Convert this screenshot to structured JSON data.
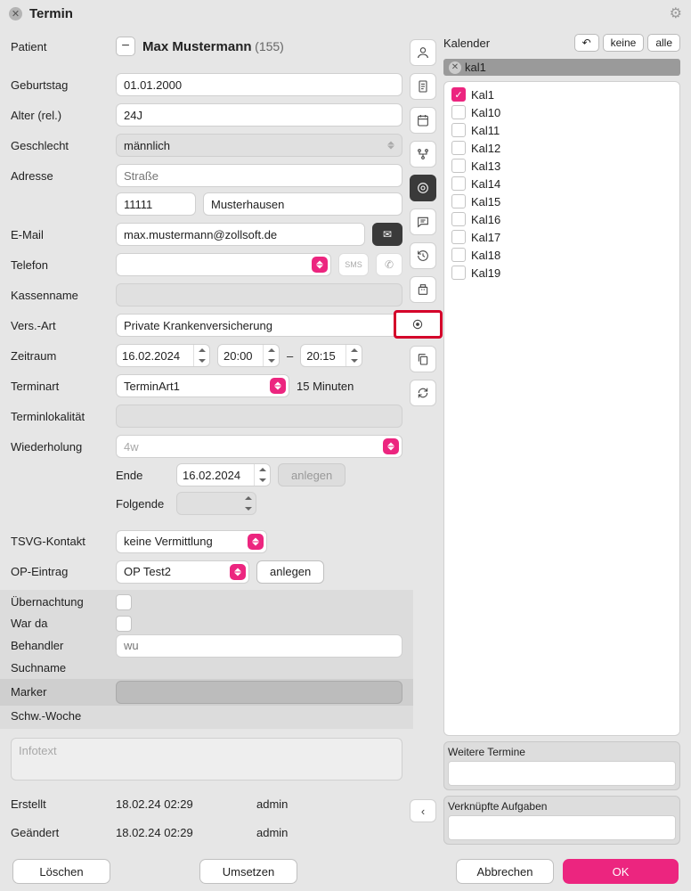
{
  "titlebar": {
    "title": "Termin"
  },
  "labels": {
    "patient": "Patient",
    "geburtstag": "Geburtstag",
    "alter": "Alter (rel.)",
    "geschlecht": "Geschlecht",
    "adresse": "Adresse",
    "email": "E-Mail",
    "telefon": "Telefon",
    "kassenname": "Kassenname",
    "versart": "Vers.-Art",
    "zeitraum": "Zeitraum",
    "terminart": "Terminart",
    "terminlokalitaet": "Terminlokalität",
    "wiederholung": "Wiederholung",
    "ende": "Ende",
    "folgende": "Folgende",
    "tsvg": "TSVG-Kontakt",
    "op": "OP-Eintrag",
    "uebernachtung": "Übernachtung",
    "warda": "War da",
    "behandler": "Behandler",
    "suchname": "Suchname",
    "marker": "Marker",
    "schwwoche": "Schw.-Woche",
    "erstellt": "Erstellt",
    "geaendert": "Geändert"
  },
  "patient": {
    "name": "Max Mustermann",
    "number": "(155)"
  },
  "values": {
    "geburtstag": "01.01.2000",
    "alter": "24J",
    "geschlecht": "männlich",
    "strasse_ph": "Straße",
    "plz": "11111",
    "ort": "Musterhausen",
    "email": "max.mustermann@zollsoft.de",
    "telefon": "",
    "kassenname": "",
    "versart": "Private Krankenversicherung",
    "datum": "16.02.2024",
    "start": "20:00",
    "dash": "–",
    "end": "20:15",
    "dauer": "15 Minuten",
    "terminart": "TerminArt1",
    "wiederholung_ph": "4w",
    "ende_date": "16.02.2024",
    "folgende": "",
    "tsvg": "keine Vermittlung",
    "op": "OP Test2",
    "behandler_ph": "wu",
    "infotext_ph": "Infotext",
    "erstellt_date": "18.02.24 02:29",
    "erstellt_user": "admin",
    "geaendert_date": "18.02.24 02:29",
    "geaendert_user": "admin"
  },
  "buttons": {
    "anlegen": "anlegen",
    "anlegen2": "anlegen",
    "loeschen": "Löschen",
    "umsetzen": "Umsetzen",
    "abbrechen": "Abbrechen",
    "ok": "OK",
    "sms": "SMS"
  },
  "calendar": {
    "title": "Kalender",
    "undo": "↶",
    "none": "keine",
    "all": "alle",
    "selected": "kal1",
    "items": [
      {
        "label": "Kal1",
        "checked": true
      },
      {
        "label": "Kal10",
        "checked": false
      },
      {
        "label": "Kal11",
        "checked": false
      },
      {
        "label": "Kal12",
        "checked": false
      },
      {
        "label": "Kal13",
        "checked": false
      },
      {
        "label": "Kal14",
        "checked": false
      },
      {
        "label": "Kal15",
        "checked": false
      },
      {
        "label": "Kal16",
        "checked": false
      },
      {
        "label": "Kal17",
        "checked": false
      },
      {
        "label": "Kal18",
        "checked": false
      },
      {
        "label": "Kal19",
        "checked": false
      }
    ]
  },
  "panels": {
    "weitere": "Weitere Termine",
    "aufgaben": "Verknüpfte Aufgaben"
  }
}
